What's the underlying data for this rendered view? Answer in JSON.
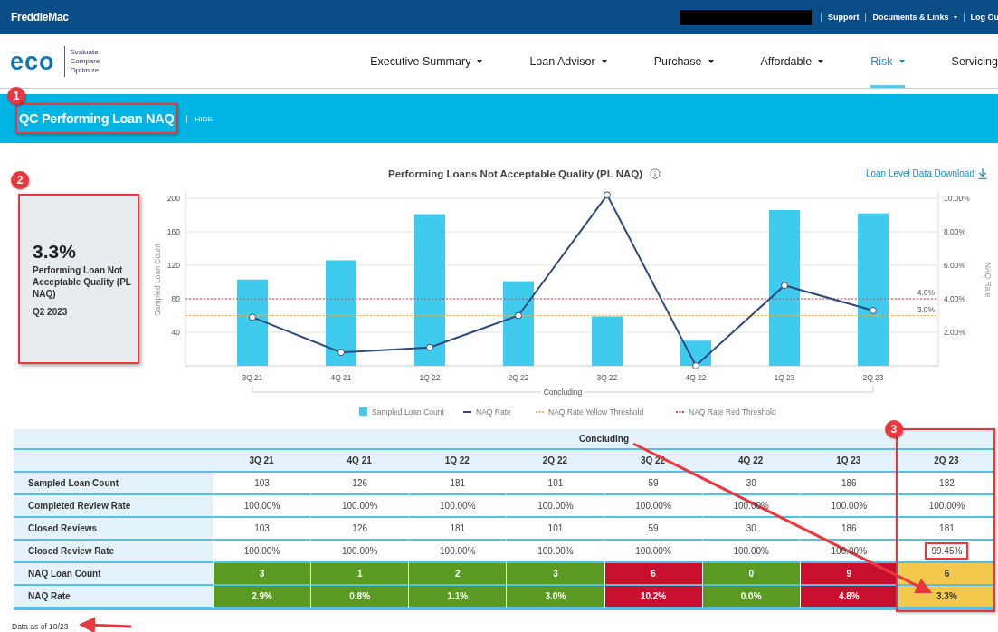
{
  "top_bar": {
    "logo": "FreddieMac",
    "redacted": true,
    "links": [
      {
        "label": "Support",
        "caret": false
      },
      {
        "label": "Documents & Links",
        "caret": true
      },
      {
        "label": "Log Ou",
        "caret": false
      }
    ]
  },
  "brand": {
    "logo": "eco",
    "tagline": [
      "Evaluate",
      "Compare",
      "Optimize"
    ]
  },
  "nav": [
    {
      "label": "Executive Summary",
      "selected": false
    },
    {
      "label": "Loan Advisor",
      "selected": false
    },
    {
      "label": "Purchase",
      "selected": false
    },
    {
      "label": "Affordable",
      "selected": false
    },
    {
      "label": "Risk",
      "selected": true
    },
    {
      "label": "Servicing",
      "selected": false,
      "caret": false
    }
  ],
  "banner": {
    "title": "QC Performing Loan NAQ",
    "highlighted": true,
    "badge": "1",
    "hide": "HIDE"
  },
  "kpi": {
    "value": "3.3%",
    "label": "Performing Loan Not Acceptable Quality (PL NAQ)",
    "period": "Q2 2023",
    "highlighted": true,
    "badge": "2"
  },
  "chart": {
    "download": "Loan Level Data Download",
    "chart_data": {
      "type": "bar",
      "title": "Performing Loans Not Acceptable Quality (PL NAQ)",
      "ylabel": "Sampled Loan Count",
      "y2label": "NAQ Rate",
      "categories": [
        "3Q 21",
        "4Q 21",
        "1Q 22",
        "2Q 22",
        "3Q 22",
        "4Q 22",
        "1Q 23",
        "2Q 23"
      ],
      "xlabel": "Concluding",
      "ylim": [
        0,
        206
      ],
      "yticks": [
        40,
        80,
        120,
        160,
        200
      ],
      "y2lim": [
        0,
        10.3
      ],
      "y2ticks": [
        {
          "value": 2,
          "label": "2.00%"
        },
        {
          "value": 4,
          "label": "4.00%"
        },
        {
          "value": 6,
          "label": "6.00%"
        },
        {
          "value": 8,
          "label": "8.00%"
        },
        {
          "value": 10,
          "label": "10.00%"
        }
      ],
      "series": [
        {
          "name": "Sampled Loan Count",
          "color": "#3fcbee",
          "values": [
            103,
            126,
            181,
            101,
            59,
            30,
            186,
            182
          ]
        },
        {
          "name": "NAQ Rate",
          "type": "line",
          "axis": "y2",
          "marker": true,
          "color": "#2d4a7e",
          "values": [
            2.9,
            0.8,
            1.1,
            3.0,
            10.2,
            0.0,
            4.8,
            3.3
          ]
        }
      ],
      "ref_lines": [
        {
          "label": "NAQ Rate Yellow Threshold",
          "color": "#f5b342",
          "axis": "y2",
          "value": 3
        },
        {
          "label": "NAQ Rate Red Threshold",
          "color": "#d9434f",
          "axis": "y2",
          "value": 4
        }
      ],
      "annotations": [
        "3.0%",
        "4.0%"
      ],
      "grid": true,
      "legend": true
    }
  },
  "table": {
    "group": "Concluding",
    "columns": [
      {
        "label": "3Q 21"
      },
      {
        "label": "4Q 21"
      },
      {
        "label": "1Q 22"
      },
      {
        "label": "2Q 22"
      },
      {
        "label": "3Q 22"
      },
      {
        "label": "4Q 22"
      },
      {
        "label": "1Q 23"
      },
      {
        "label": "2Q 23",
        "highlighted": true,
        "badge": "3"
      }
    ],
    "rows": [
      {
        "label": "Sampled Loan Count",
        "cells": [
          {
            "text": "103"
          },
          {
            "text": "126"
          },
          {
            "text": "181"
          },
          {
            "text": "101"
          },
          {
            "text": "59"
          },
          {
            "text": "30"
          },
          {
            "text": "186"
          },
          {
            "text": "182"
          }
        ]
      },
      {
        "label": "Completed Review Rate",
        "cells": [
          {
            "text": "100.00%"
          },
          {
            "text": "100.00%"
          },
          {
            "text": "100.00%"
          },
          {
            "text": "100.00%"
          },
          {
            "text": "100.00%"
          },
          {
            "text": "100.00%"
          },
          {
            "text": "100.00%"
          },
          {
            "text": "100.00%"
          }
        ]
      },
      {
        "label": "Closed Reviews",
        "cells": [
          {
            "text": "103"
          },
          {
            "text": "126"
          },
          {
            "text": "181"
          },
          {
            "text": "101"
          },
          {
            "text": "59"
          },
          {
            "text": "30"
          },
          {
            "text": "186"
          },
          {
            "text": "181"
          }
        ]
      },
      {
        "label": "Closed Review Rate",
        "cells": [
          {
            "text": "100.00%"
          },
          {
            "text": "100.00%"
          },
          {
            "text": "100.00%"
          },
          {
            "text": "100.00%"
          },
          {
            "text": "100.00%"
          },
          {
            "text": "100.00%"
          },
          {
            "text": "100.00%"
          },
          {
            "text": "99.45%",
            "highlighted": true
          }
        ]
      },
      {
        "label": "NAQ Loan Count",
        "cells": [
          {
            "text": "3",
            "color": "#5a9a22"
          },
          {
            "text": "1",
            "color": "#5a9a22"
          },
          {
            "text": "2",
            "color": "#5a9a22"
          },
          {
            "text": "3",
            "color": "#5a9a22"
          },
          {
            "text": "6",
            "color": "#c8102e"
          },
          {
            "text": "0",
            "color": "#5a9a22"
          },
          {
            "text": "9",
            "color": "#c8102e"
          },
          {
            "text": "6",
            "color": "#f2c94c"
          }
        ]
      },
      {
        "label": "NAQ Rate",
        "cells": [
          {
            "text": "2.9%",
            "color": "#5a9a22"
          },
          {
            "text": "0.8%",
            "color": "#5a9a22"
          },
          {
            "text": "1.1%",
            "color": "#5a9a22"
          },
          {
            "text": "3.0%",
            "color": "#5a9a22"
          },
          {
            "text": "10.2%",
            "color": "#c8102e"
          },
          {
            "text": "0.0%",
            "color": "#5a9a22"
          },
          {
            "text": "4.8%",
            "color": "#c8102e"
          },
          {
            "text": "3.3%",
            "color": "#f2c94c"
          }
        ]
      }
    ]
  },
  "footer": {
    "note": "Data as of 10/23"
  }
}
